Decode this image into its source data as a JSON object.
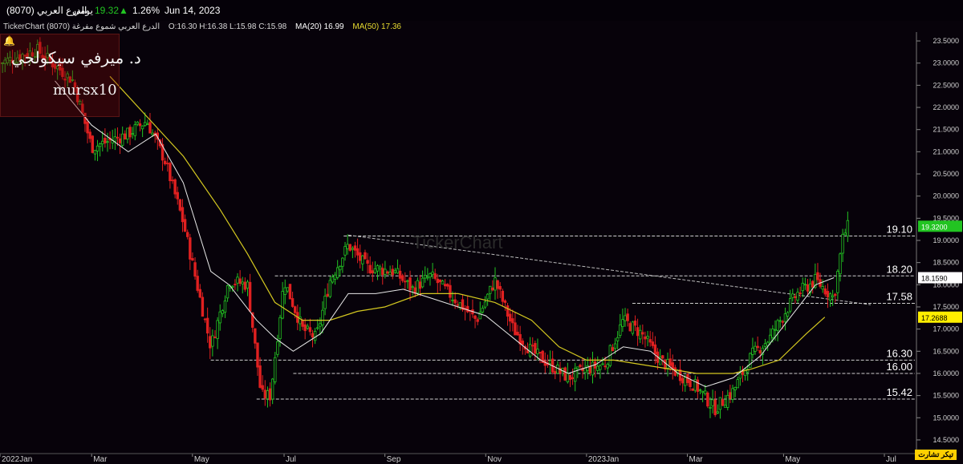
{
  "header": {
    "name": "(8070) الدرع العربي",
    "period": "يومي",
    "price": "19.32",
    "change_arrow": "▲",
    "change_pct": "1.26%",
    "date": "Jun 14, 2023"
  },
  "info": {
    "description": "TickerChart الدرع العربي شموع مفرغة (8070)",
    "ohlc": "O:16.30  H:16.38  L:15.98  C:15.98",
    "ma20": "MA(20)  16.99",
    "ma50": "MA(50)  17.36"
  },
  "watermark": {
    "author": "د. ميرفي سيكولجي",
    "handle": "mursx10",
    "center": "TickerChart"
  },
  "footer_logo": "تيكر تشارت",
  "colors": {
    "background": "#07020a",
    "up": "#22c422",
    "down": "#e02020",
    "ma20": "#e8e8e8",
    "ma50": "#d4c820",
    "level_line": "#cfcfcf",
    "last_price_badge": "#22c422",
    "ma20_badge": "#ffffff",
    "ma50_badge": "#ffee00"
  },
  "chart_data": {
    "type": "candlestick",
    "x_ticks": [
      "2022Jan",
      "Mar",
      "May",
      "Jul",
      "Sep",
      "Nov",
      "2023Jan",
      "Mar",
      "May",
      "Jul"
    ],
    "y_ticks": [
      "14.5000",
      "15.0000",
      "15.5000",
      "16.0000",
      "16.5000",
      "17.0000",
      "17.5000",
      "18.0000",
      "18.5000",
      "19.0000",
      "19.5000",
      "20.0000",
      "20.5000",
      "21.0000",
      "21.5000",
      "22.0000",
      "22.5000",
      "23.0000",
      "23.5000"
    ],
    "ylim": [
      14.3,
      23.7
    ],
    "levels": [
      {
        "value": 19.1,
        "label": "19.10",
        "x_start": 0.375
      },
      {
        "value": 18.2,
        "label": "18.20",
        "x_start": 0.3
      },
      {
        "value": 17.58,
        "label": "17.58",
        "x_start": 0.69
      },
      {
        "value": 16.3,
        "label": "16.30",
        "x_start": 0.23
      },
      {
        "value": 16.0,
        "label": "16.00",
        "x_start": 0.32
      },
      {
        "value": 15.42,
        "label": "15.42",
        "x_start": 0.28
      }
    ],
    "trendline": {
      "from": [
        0.38,
        19.12
      ],
      "to": [
        0.95,
        17.55
      ]
    },
    "last_price": "19.3200",
    "ma20_value": "18.1590",
    "ma50_value": "17.2688",
    "ma20_badge_value": 18.159,
    "ma50_badge_value": 17.2688,
    "last_price_value": 19.32,
    "series": [
      {
        "name": "price_path",
        "points": [
          [
            0.0,
            23.0
          ],
          [
            0.04,
            23.3
          ],
          [
            0.08,
            22.6
          ],
          [
            0.1,
            21.1
          ],
          [
            0.14,
            21.4
          ],
          [
            0.16,
            21.7
          ],
          [
            0.18,
            20.8
          ],
          [
            0.2,
            19.4
          ],
          [
            0.215,
            18.0
          ],
          [
            0.23,
            16.6
          ],
          [
            0.25,
            18.1
          ],
          [
            0.27,
            18.0
          ],
          [
            0.285,
            15.5
          ],
          [
            0.295,
            15.5
          ],
          [
            0.31,
            18.1
          ],
          [
            0.33,
            17.0
          ],
          [
            0.345,
            16.8
          ],
          [
            0.36,
            18.1
          ],
          [
            0.38,
            18.9
          ],
          [
            0.4,
            18.4
          ],
          [
            0.43,
            18.3
          ],
          [
            0.45,
            17.9
          ],
          [
            0.47,
            18.2
          ],
          [
            0.5,
            17.6
          ],
          [
            0.52,
            17.2
          ],
          [
            0.54,
            18.1
          ],
          [
            0.56,
            17.0
          ],
          [
            0.58,
            16.5
          ],
          [
            0.6,
            16.2
          ],
          [
            0.62,
            15.9
          ],
          [
            0.64,
            16.1
          ],
          [
            0.66,
            16.2
          ],
          [
            0.68,
            17.2
          ],
          [
            0.7,
            16.9
          ],
          [
            0.72,
            16.3
          ],
          [
            0.74,
            16.0
          ],
          [
            0.76,
            15.7
          ],
          [
            0.78,
            15.2
          ],
          [
            0.8,
            15.6
          ],
          [
            0.82,
            16.4
          ],
          [
            0.84,
            16.8
          ],
          [
            0.86,
            17.5
          ],
          [
            0.87,
            17.8
          ],
          [
            0.89,
            18.1
          ],
          [
            0.91,
            17.7
          ],
          [
            0.92,
            19.1
          ],
          [
            0.925,
            19.3
          ]
        ]
      },
      {
        "name": "ma20_path",
        "points": [
          [
            0.06,
            22.6
          ],
          [
            0.1,
            21.6
          ],
          [
            0.14,
            21.0
          ],
          [
            0.17,
            21.4
          ],
          [
            0.2,
            20.3
          ],
          [
            0.23,
            18.3
          ],
          [
            0.25,
            18.0
          ],
          [
            0.28,
            17.2
          ],
          [
            0.3,
            16.8
          ],
          [
            0.32,
            16.5
          ],
          [
            0.35,
            16.9
          ],
          [
            0.38,
            17.8
          ],
          [
            0.41,
            17.8
          ],
          [
            0.44,
            17.9
          ],
          [
            0.47,
            17.7
          ],
          [
            0.5,
            17.5
          ],
          [
            0.53,
            17.3
          ],
          [
            0.56,
            16.8
          ],
          [
            0.59,
            16.3
          ],
          [
            0.62,
            16.0
          ],
          [
            0.65,
            16.2
          ],
          [
            0.68,
            16.6
          ],
          [
            0.71,
            16.5
          ],
          [
            0.74,
            16.0
          ],
          [
            0.77,
            15.7
          ],
          [
            0.8,
            15.9
          ],
          [
            0.83,
            16.4
          ],
          [
            0.86,
            17.2
          ],
          [
            0.89,
            18.0
          ],
          [
            0.91,
            18.16
          ]
        ]
      },
      {
        "name": "ma50_path",
        "points": [
          [
            0.12,
            22.7
          ],
          [
            0.16,
            21.8
          ],
          [
            0.2,
            20.9
          ],
          [
            0.24,
            19.7
          ],
          [
            0.27,
            18.7
          ],
          [
            0.3,
            17.6
          ],
          [
            0.33,
            17.2
          ],
          [
            0.36,
            17.2
          ],
          [
            0.39,
            17.4
          ],
          [
            0.42,
            17.5
          ],
          [
            0.46,
            17.8
          ],
          [
            0.5,
            17.8
          ],
          [
            0.54,
            17.6
          ],
          [
            0.58,
            17.2
          ],
          [
            0.61,
            16.6
          ],
          [
            0.64,
            16.3
          ],
          [
            0.67,
            16.3
          ],
          [
            0.7,
            16.2
          ],
          [
            0.73,
            16.1
          ],
          [
            0.76,
            16.0
          ],
          [
            0.78,
            16.0
          ],
          [
            0.8,
            16.0
          ],
          [
            0.82,
            16.1
          ],
          [
            0.85,
            16.3
          ],
          [
            0.88,
            16.9
          ],
          [
            0.9,
            17.27
          ]
        ]
      }
    ]
  }
}
